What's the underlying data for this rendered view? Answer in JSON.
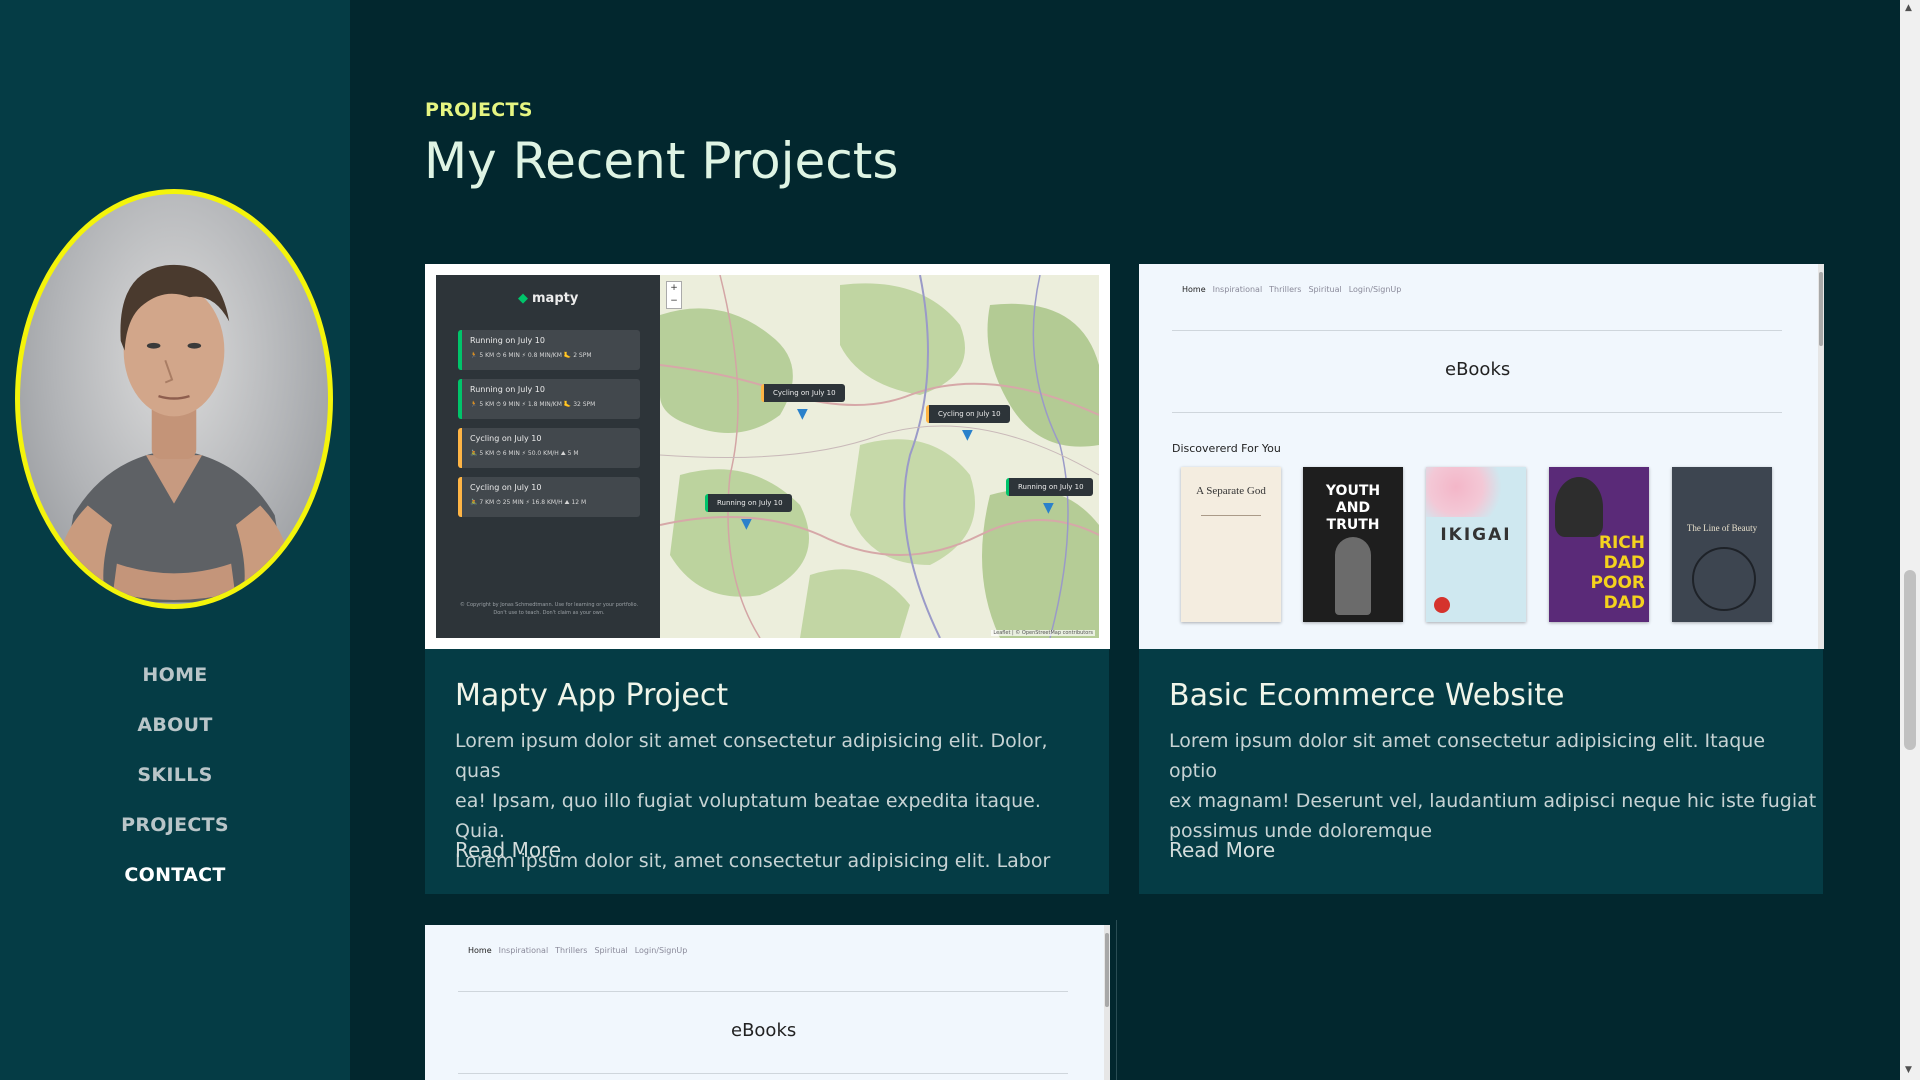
{
  "nav": {
    "items": [
      {
        "label": "HOME"
      },
      {
        "label": "ABOUT"
      },
      {
        "label": "SKILLS"
      },
      {
        "label": "PROJECTS"
      },
      {
        "label": "CONTACT"
      }
    ]
  },
  "section": {
    "tag": "PROJECTS",
    "title": "My Recent Projects"
  },
  "projects": [
    {
      "title": "Mapty App Project",
      "desc_lines": [
        "Lorem ipsum dolor sit amet consectetur adipisicing elit. Dolor, quas",
        "ea! Ipsam, quo illo fugiat voluptatum beatae expedita itaque. Quia.",
        "Lorem ipsum dolor sit, amet consectetur adipisicing elit. Labor"
      ],
      "link": "Read More"
    },
    {
      "title": "Basic Ecommerce Website",
      "desc_lines": [
        "Lorem ipsum dolor sit amet consectetur adipisicing elit. Itaque optio",
        "ex magnam! Deserunt vel, laudantium adipisci neque hic iste fugiat",
        "possimus unde doloremque"
      ],
      "link": "Read More"
    }
  ],
  "mapty": {
    "logo": "mapty",
    "workouts": [
      {
        "title": "Running on July 10",
        "stats": "🏃 5 KM   ⏱ 6 MIN   ⚡ 0.8 MIN/KM   🦶 2 SPM"
      },
      {
        "title": "Running on July 10",
        "stats": "🏃 5 KM   ⏱ 9 MIN   ⚡ 1.8 MIN/KM   🦶 32 SPM"
      },
      {
        "title": "Cycling on July 10",
        "stats": "🚴 5 KM   ⏱ 6 MIN   ⚡ 50.0 KM/H   ⛰ 5 M"
      },
      {
        "title": "Cycling on July 10",
        "stats": "🚴 7 KM   ⏱ 25 MIN   ⚡ 16.8 KM/H   ⛰ 12 M"
      }
    ],
    "footer": "© Copyright by Jonas Schmedtmann. Use for learning or your portfolio. Don't use to teach. Don't claim as your own.",
    "popups": [
      "Cycling on July 10",
      "Cycling on July 10",
      "Running on July 10",
      "Running on July 10"
    ],
    "attribution": "Leaflet | © OpenStreetMap contributors",
    "zoom_in": "+",
    "zoom_out": "−"
  },
  "ebooks": {
    "nav": [
      "Home",
      "Inspirational",
      "Thrillers",
      "Spiritual",
      "Login/SignUp"
    ],
    "title": "eBooks",
    "subtitle": "Discovererd For You",
    "books": [
      {
        "title": "A Separate God",
        "color": "#f4ede0"
      },
      {
        "title": "YOUTH AND TRUTH",
        "color": "#1e1e1e"
      },
      {
        "title": "IKIGAI",
        "color": "#cfe8f0"
      },
      {
        "title": "RICH DAD POOR DAD",
        "color": "#5a2a78"
      },
      {
        "title": "The Line of Beauty",
        "color": "#3d4550"
      }
    ]
  },
  "colors": {
    "background": "#02272e",
    "sidebar": "#053c45",
    "accent": "#e6f582",
    "avatar_border": "#f4f40a"
  }
}
